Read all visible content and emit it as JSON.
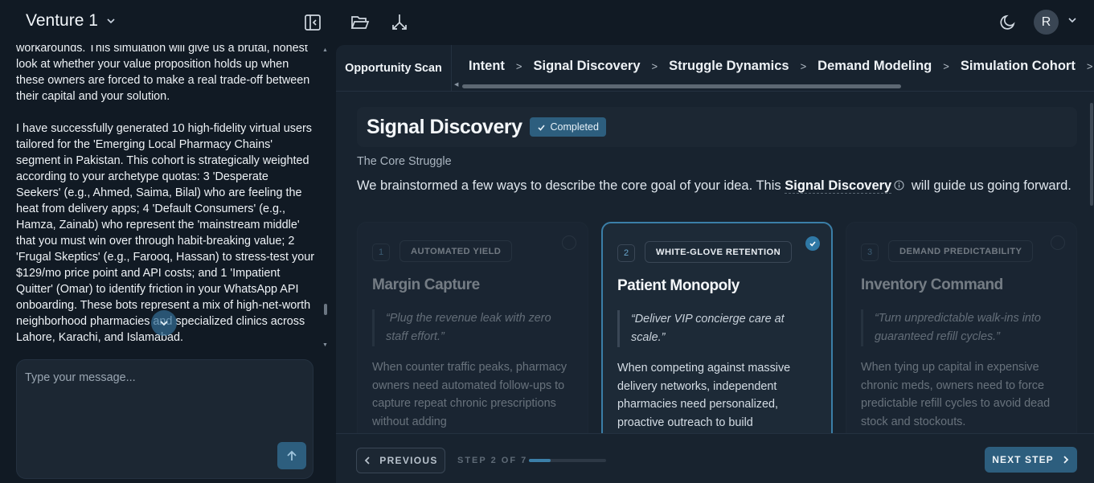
{
  "header": {
    "venture_name": "Venture 1",
    "avatar_initial": "R",
    "icons": [
      "collapse-sidebar-icon",
      "folder-open-icon",
      "branch-merge-icon",
      "moon-icon"
    ]
  },
  "chat": {
    "paragraph_1": "workarounds. This simulation will give us a brutal, honest look at whether your value proposition holds up when these owners are forced to make a real trade-off between their capital and your solution.",
    "paragraph_2": "I have successfully generated 10 high-fidelity virtual users tailored for the 'Emerging Local Pharmacy Chains' segment in Pakistan. This cohort is strategically weighted according to your archetype quotas: 3 'Desperate Seekers' (e.g., Ahmed, Saima, Bilal) who are feeling the heat from delivery apps; 4 'Default Consumers' (e.g., Hamza, Zainab) who represent the 'mainstream middle' that you must win over through habit-breaking value; 2 'Frugal Skeptics' (e.g., Farooq, Hassan) to stress-test your $129/mo price point and API costs; and 1 'Impatient Quitter' (Omar) to identify friction in your WhatsApp API onboarding. These bots represent a mix of high-net-worth neighborhood pharmacies and specialized clinics across Lahore, Karachi, and Islamabad.",
    "composer_placeholder": "Type your message..."
  },
  "breadcrumb": {
    "root": "Opportunity Scan",
    "steps": [
      "Intent",
      "Signal Discovery",
      "Struggle Dynamics",
      "Demand Modeling",
      "Simulation Cohort"
    ]
  },
  "page": {
    "title": "Signal Discovery",
    "status_badge": "Completed",
    "section_label": "The Core Struggle",
    "intro_before": "We brainstormed a few ways to describe the core goal of your idea. This",
    "intro_term": "Signal Discovery",
    "intro_after": "will guide us going forward."
  },
  "cards": [
    {
      "number": "1",
      "tag": "AUTOMATED YIELD",
      "title": "Margin Capture",
      "quote": "“Plug the revenue leak with zero staff effort.”",
      "description": "When counter traffic peaks, pharmacy owners need automated follow-ups to capture repeat chronic prescriptions without adding"
    },
    {
      "number": "2",
      "tag": "WHITE-GLOVE RETENTION",
      "title": "Patient Monopoly",
      "quote": "“Deliver VIP concierge care at scale.”",
      "description": "When competing against massive delivery networks, independent pharmacies need personalized, proactive outreach to build"
    },
    {
      "number": "3",
      "tag": "DEMAND PREDICTABILITY",
      "title": "Inventory Command",
      "quote": "“Turn unpredictable walk-ins into guaranteed refill cycles.”",
      "description": "When tying up capital in expensive chronic meds, owners need to force predictable refill cycles to avoid dead stock and stockouts."
    }
  ],
  "selected_card": 2,
  "footer": {
    "previous_label": "PREVIOUS",
    "step_label": "STEP 2 OF 7",
    "step_current": 2,
    "step_total": 7,
    "next_label": "NEXT STEP"
  },
  "colors": {
    "background": "#111a24",
    "panel": "#18232f",
    "accent": "#2d5e7e",
    "accent_bright": "#3b7fa8"
  }
}
